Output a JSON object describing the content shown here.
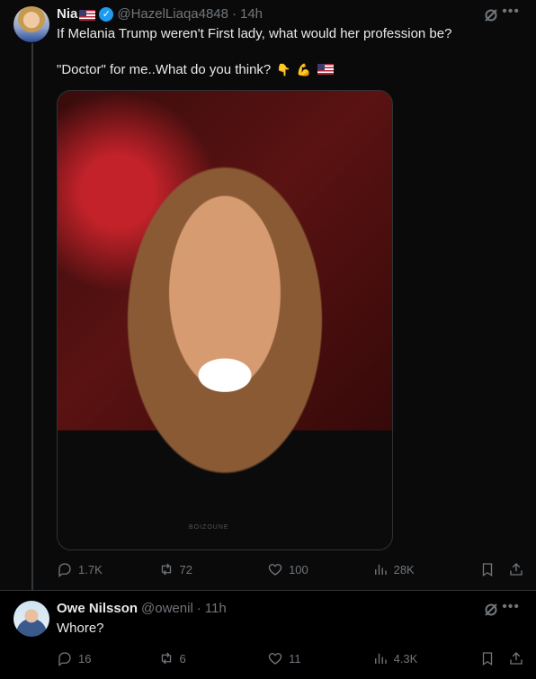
{
  "post": {
    "name": "Nia",
    "handle": "@HazelLiaqa4848",
    "separator": "·",
    "time": "14h",
    "text_line1": "If Melania Trump weren't First lady, what would her profession be?",
    "text_line2": "\"Doctor\" for me..What do you think?",
    "photo_watermark": "BOIZOUNE",
    "stats": {
      "replies": "1.7K",
      "reposts": "72",
      "likes": "100",
      "views": "28K"
    }
  },
  "reply": {
    "name": "Owe Nilsson",
    "handle": "@owenil",
    "separator": "·",
    "time": "11h",
    "text": "Whore?",
    "stats": {
      "replies": "16",
      "reposts": "6",
      "likes": "11",
      "views": "4.3K"
    }
  },
  "icons": [
    "grok-icon",
    "more-icon",
    "reply-icon",
    "repost-icon",
    "like-icon",
    "views-icon",
    "bookmark-icon",
    "share-icon",
    "verified-icon",
    "us-flag-icon"
  ],
  "colors": {
    "background": "#000000",
    "text": "#e7e9ea",
    "muted": "#71767b",
    "verified": "#1d9bf0",
    "divider": "#2f3336"
  }
}
